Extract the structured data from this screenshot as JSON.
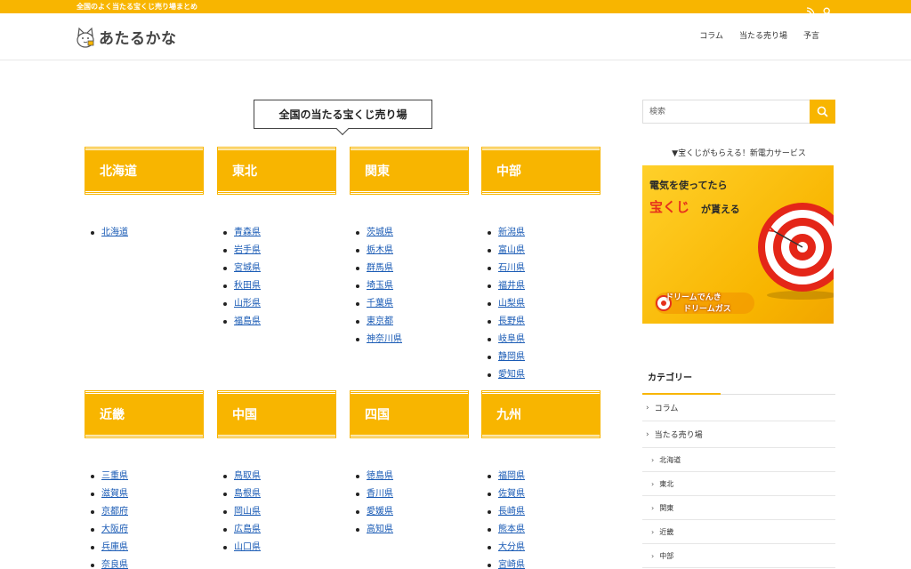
{
  "site": {
    "tagline": "全国のよく当たる宝くじ売り場まとめ",
    "logo_text": "あたるかな"
  },
  "nav": [
    "コラム",
    "当たる売り場",
    "予言"
  ],
  "section_title": "全国の当たる宝くじ売り場",
  "regions": [
    {
      "name": "北海道",
      "prefectures": [
        "北海道"
      ]
    },
    {
      "name": "東北",
      "prefectures": [
        "青森県",
        "岩手県",
        "宮城県",
        "秋田県",
        "山形県",
        "福島県"
      ]
    },
    {
      "name": "関東",
      "prefectures": [
        "茨城県",
        "栃木県",
        "群馬県",
        "埼玉県",
        "千葉県",
        "東京都",
        "神奈川県"
      ]
    },
    {
      "name": "中部",
      "prefectures": [
        "新潟県",
        "富山県",
        "石川県",
        "福井県",
        "山梨県",
        "長野県",
        "岐阜県",
        "静岡県",
        "愛知県"
      ]
    },
    {
      "name": "近畿",
      "prefectures": [
        "三重県",
        "滋賀県",
        "京都府",
        "大阪府",
        "兵庫県",
        "奈良県"
      ]
    },
    {
      "name": "中国",
      "prefectures": [
        "鳥取県",
        "島根県",
        "岡山県",
        "広島県",
        "山口県"
      ]
    },
    {
      "name": "四国",
      "prefectures": [
        "徳島県",
        "香川県",
        "愛媛県",
        "高知県"
      ]
    },
    {
      "name": "九州",
      "prefectures": [
        "福岡県",
        "佐賀県",
        "長崎県",
        "熊本県",
        "大分県",
        "宮崎県"
      ]
    }
  ],
  "sidebar": {
    "search_placeholder": "検索",
    "promo_title": "▼宝くじがもらえる！新電力サービス",
    "banner": {
      "line1": "電気を使ってたら",
      "line2_red": "宝くじ",
      "line2_rest": "が貰える",
      "brand1": "ドリームでんき",
      "brand2": "ドリームガス"
    },
    "category_heading": "カテゴリー",
    "categories": [
      "コラム",
      "当たる売り場"
    ],
    "subcategories": [
      "北海道",
      "東北",
      "関東",
      "近畿",
      "中部"
    ]
  },
  "colors": {
    "brand": "#f8b500",
    "link": "#1a5bb5",
    "accent_red": "#e6311c"
  }
}
